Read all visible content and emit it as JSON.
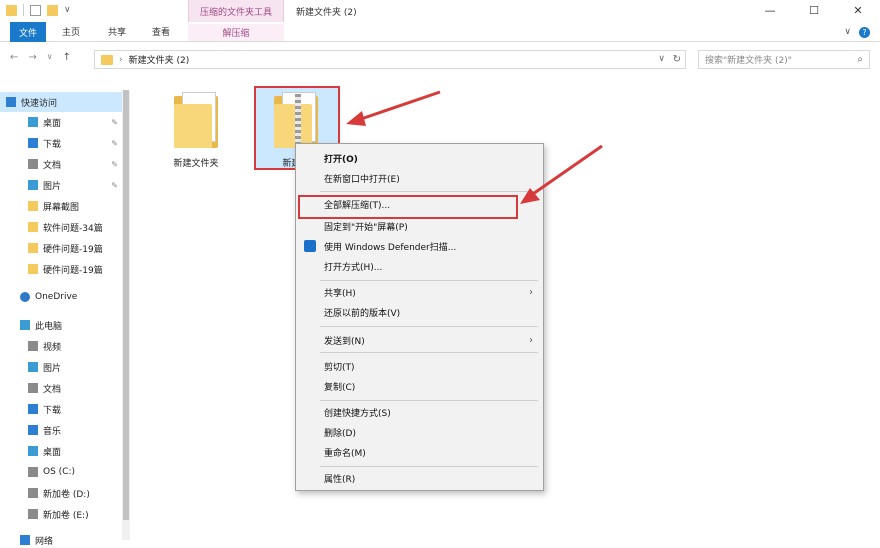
{
  "window": {
    "tools_tab_title": "压缩的文件夹工具",
    "title": "新建文件夹 (2)",
    "minimize": "—",
    "maximize": "☐",
    "close": "✕"
  },
  "ribbon": {
    "tabs": [
      "文件",
      "主页",
      "共享",
      "查看"
    ],
    "extract_tab": "解压缩",
    "expand": "∨",
    "help": "?"
  },
  "address": {
    "back": "←",
    "forward": "→",
    "recent": "∨",
    "up": "↑",
    "separator": "›",
    "path": "新建文件夹 (2)",
    "refresh": "↻",
    "dropdown": "∨",
    "search_placeholder": "搜索\"新建文件夹 (2)\"",
    "search_icon": "⌕"
  },
  "nav_pane": {
    "quick_access": "快速访问",
    "items": [
      {
        "label": "桌面",
        "pinned": true
      },
      {
        "label": "下载",
        "pinned": true
      },
      {
        "label": "文档",
        "pinned": true
      },
      {
        "label": "图片",
        "pinned": true
      },
      {
        "label": "屏幕截图",
        "pinned": false
      },
      {
        "label": "软件问题-34篇",
        "pinned": false
      },
      {
        "label": "硬件问题-19篇",
        "pinned": false
      },
      {
        "label": "硬件问题-19篇",
        "pinned": false
      }
    ],
    "onedrive": "OneDrive",
    "this_pc": "此电脑",
    "pc_items": [
      "视频",
      "图片",
      "文档",
      "下载",
      "音乐",
      "桌面",
      "OS (C:)",
      "新加卷 (D:)",
      "新加卷 (E:)"
    ],
    "network": "网络",
    "pin_glyph": "✎"
  },
  "content": {
    "files": [
      {
        "label": "新建文件夹"
      },
      {
        "label": "新建文"
      }
    ]
  },
  "context_menu": {
    "items": [
      "打开(O)",
      "在新窗口中打开(E)",
      "全部解压缩(T)...",
      "固定到\"开始\"屏幕(P)",
      "使用 Windows Defender扫描...",
      "打开方式(H)...",
      "共享(H)",
      "还原以前的版本(V)",
      "发送到(N)",
      "剪切(T)",
      "复制(C)",
      "创建快捷方式(S)",
      "删除(D)",
      "重命名(M)",
      "属性(R)"
    ],
    "submenu_arrow": "›"
  },
  "colors": {
    "accent": "#1979ca",
    "annotation": "#d63a3a",
    "selection": "#cce8ff"
  }
}
